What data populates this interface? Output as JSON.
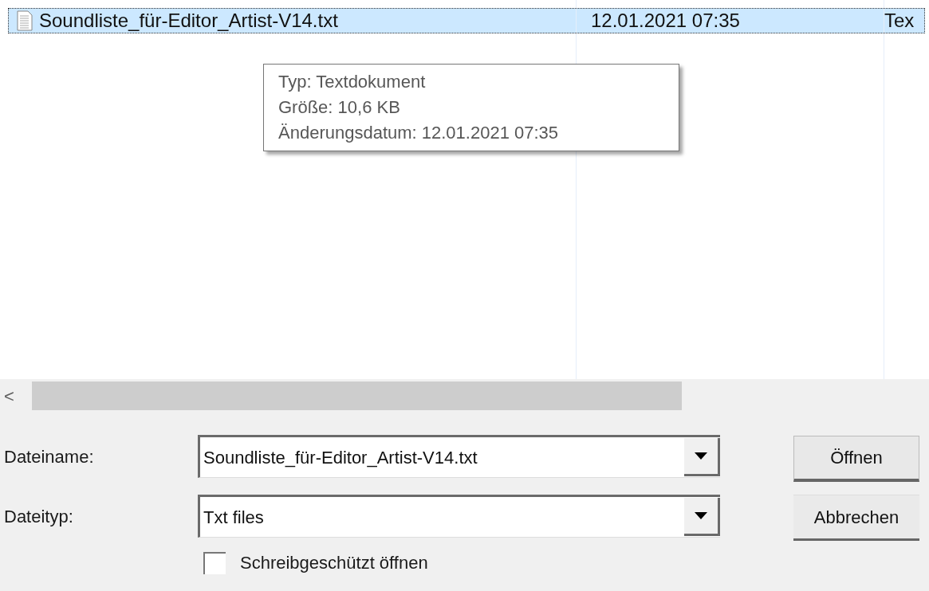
{
  "file_list": {
    "rows": [
      {
        "name": "Soundliste_für-Editor_Artist-V14.txt",
        "date": "12.01.2021 07:35",
        "type": "Tex",
        "selected": true
      }
    ]
  },
  "tooltip": {
    "lines": [
      "Typ: Textdokument",
      "Größe: 10,6 KB",
      "Änderungsdatum: 12.01.2021 07:35"
    ]
  },
  "scroll_arrow": "<",
  "file_name": {
    "label": "Dateiname:",
    "value": "Soundliste_für-Editor_Artist-V14.txt"
  },
  "file_type": {
    "label": "Dateityp:",
    "value": "Txt files"
  },
  "read_only": {
    "label": "Schreibgeschützt öffnen",
    "checked": false
  },
  "buttons": [
    "Öffnen",
    "Abbrechen"
  ]
}
